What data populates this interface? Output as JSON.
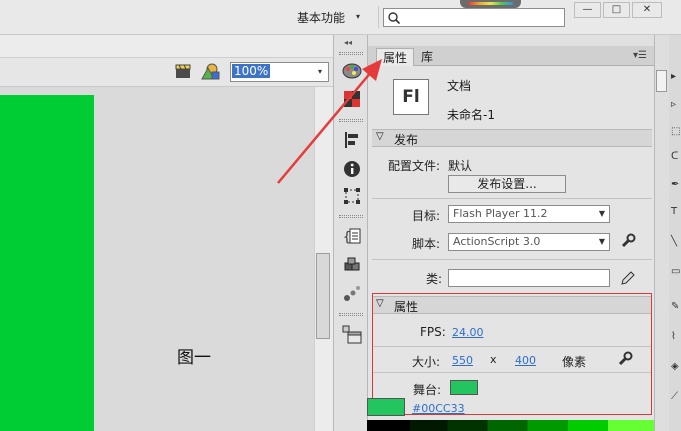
{
  "topbar": {
    "workspace_label": "基本功能",
    "workspace_caret": "▾",
    "search_placeholder": "",
    "search_icon": "search-icon",
    "minimize_glyph": "—",
    "maximize_glyph": "□",
    "close_glyph": "✕"
  },
  "edit_bar": {
    "zoom_value": "100%",
    "zoom_caret": "▾",
    "scene_icon": "edit-scene-icon",
    "symbol_icon": "edit-symbol-icon"
  },
  "stage": {
    "figure_label": "图一",
    "background_color": "#00cc33"
  },
  "toolstrip": {
    "tools": [
      "color-swatches-icon",
      "grid-swatches-icon",
      "align-icon",
      "info-icon",
      "transform-icon",
      "code-snippets-icon",
      "components-icon",
      "motion-presets-icon",
      "project-icon"
    ]
  },
  "panel": {
    "tabs": [
      {
        "label": "属性"
      },
      {
        "label": "库"
      }
    ],
    "document": {
      "icon_text": "Fl",
      "type": "文档",
      "name": "未命名-1"
    },
    "publish": {
      "section_title": "发布",
      "profile_label": "配置文件:",
      "profile_value": "默认",
      "publish_settings_button": "发布设置...",
      "target_label": "目标:",
      "target_value": "Flash Player 11.2",
      "script_label": "脚本:",
      "script_value": "ActionScript 3.0",
      "class_label": "类:",
      "class_value": ""
    },
    "properties": {
      "section_title": "属性",
      "fps_label": "FPS:",
      "fps_value": "24.00",
      "size_label": "大小:",
      "width_value": "550",
      "times": "x",
      "height_value": "400",
      "unit": "像素",
      "stage_label": "舞台:",
      "stage_color": "#00cc33",
      "stage_hex_label": "#00CC33"
    }
  },
  "annotation": {
    "arrow_color": "#e53b3b",
    "box_color": "#d53a3a"
  }
}
